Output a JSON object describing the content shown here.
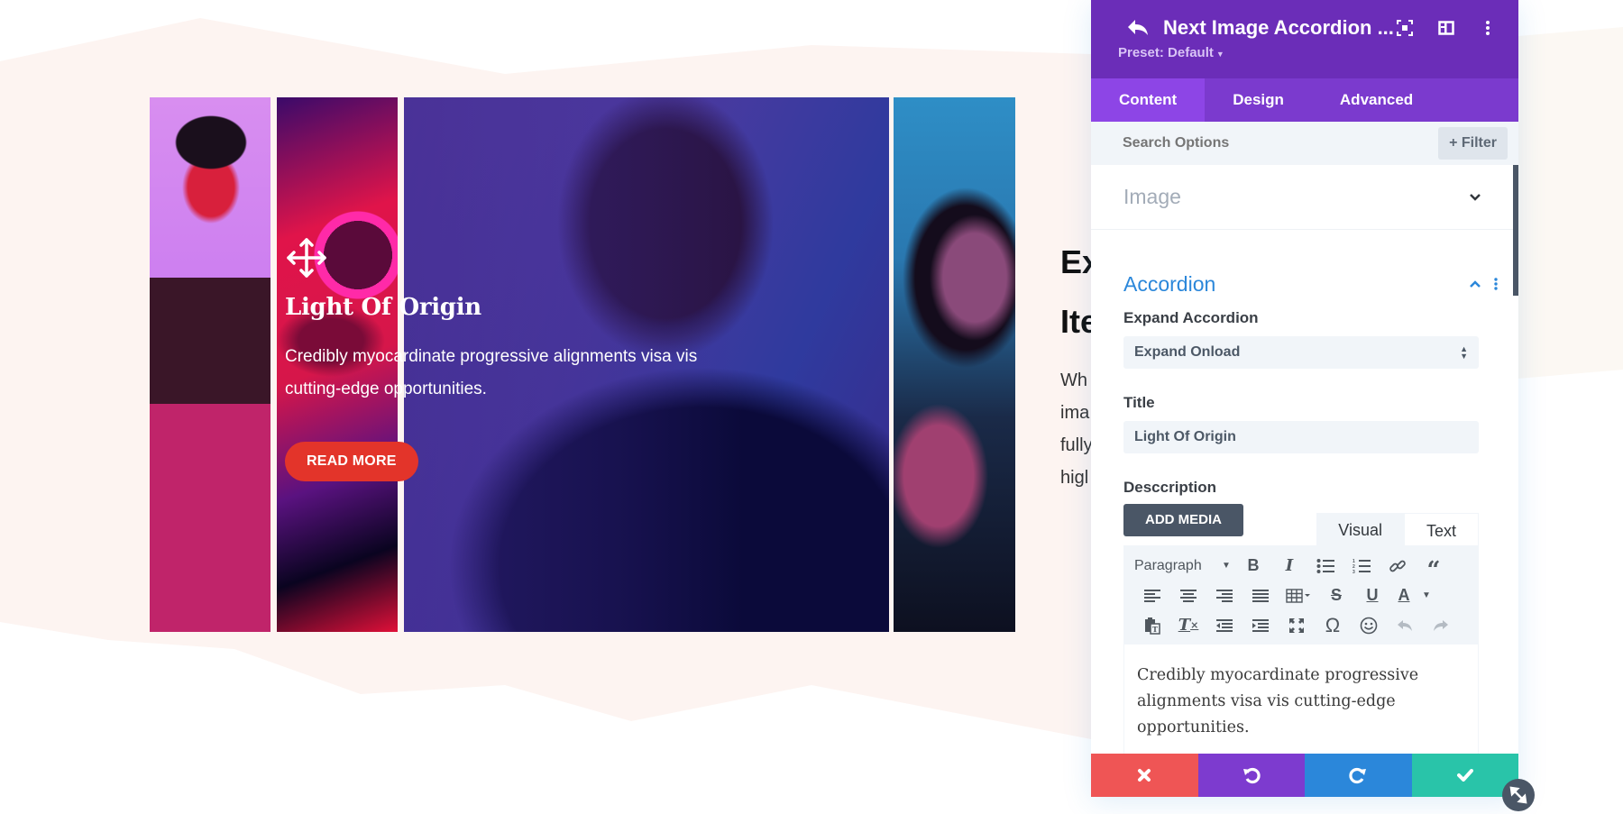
{
  "accordion": {
    "active_item": {
      "title": "Light Of Origin",
      "description": "Credibly myocardinate progressive alignments visa vis cutting-edge opportunities.",
      "button_label": "READ MORE",
      "icon": "move-arrows-icon"
    },
    "panels": [
      {
        "name": "woman-beret-pink"
      },
      {
        "name": "woman-round-glasses"
      },
      {
        "name": "woman-headphones"
      },
      {
        "name": "woman-glasses-blue"
      }
    ]
  },
  "background_section": {
    "heading_line1": "Ex",
    "heading_line2": "Ite",
    "para_lines": [
      "Wh",
      "ima",
      "fully",
      "higl"
    ]
  },
  "modal": {
    "title": "Next Image Accordion ...",
    "preset_label": "Preset: Default",
    "tabs": [
      {
        "label": "Content",
        "active": true
      },
      {
        "label": "Design",
        "active": false
      },
      {
        "label": "Advanced",
        "active": false
      }
    ],
    "search": {
      "placeholder": "Search Options",
      "filter_label": "Filter"
    },
    "sections": {
      "image": {
        "title": "Image",
        "expanded": false
      },
      "accordion": {
        "title": "Accordion",
        "expanded": true
      }
    },
    "fields": {
      "expand_accordion": {
        "label": "Expand Accordion",
        "value": "Expand Onload"
      },
      "title": {
        "label": "Title",
        "value": "Light Of Origin"
      },
      "description": {
        "label": "Desccription",
        "add_media_label": "ADD MEDIA",
        "editor_tabs": [
          "Visual",
          "Text"
        ],
        "format_select": "Paragraph",
        "content": "Credibly myocardinate progressive alignments visa vis cutting-edge opportunities."
      }
    },
    "footer": {
      "cancel": "close-icon",
      "undo": "undo-icon",
      "redo": "redo-icon",
      "save": "check-icon"
    }
  },
  "colors": {
    "header_purple": "#6b2db8",
    "tab_bar": "#7b3ace",
    "tab_active": "#8d45e6",
    "accent_blue": "#2b87da",
    "cancel_red": "#ef5555",
    "undo_purple": "#7d3bcf",
    "redo_blue": "#2b87da",
    "save_green": "#29c4a9",
    "read_more_red": "#e3342a"
  }
}
